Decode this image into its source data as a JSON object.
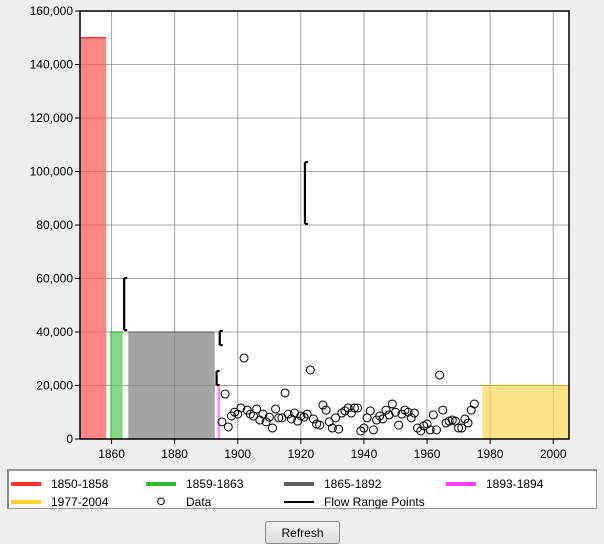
{
  "chart_data": {
    "type": "bar",
    "title": "",
    "xlabel": "",
    "ylabel": "",
    "xlim": [
      1850,
      2005
    ],
    "ylim": [
      0,
      160000
    ],
    "grid": true,
    "x_ticks": [
      1860,
      1880,
      1900,
      1920,
      1940,
      1960,
      1980,
      2000
    ],
    "y_ticks": [
      0,
      20000,
      40000,
      60000,
      80000,
      100000,
      120000,
      140000,
      160000
    ],
    "y_tick_labels": [
      "0",
      "20,000",
      "40,000",
      "60,000",
      "80,000",
      "100,000",
      "120,000",
      "140,000",
      "160,000"
    ],
    "period_bars": [
      {
        "name": "1850-1858",
        "start": 1850,
        "end": 1858.3,
        "value": 150000,
        "color": "#ff7f7f",
        "edge": "#e00000"
      },
      {
        "name": "1859-1863",
        "start": 1859.5,
        "end": 1863.5,
        "value": 40000,
        "color": "#7fd67f",
        "edge": "#20b020"
      },
      {
        "name": "1865-1892",
        "start": 1865.3,
        "end": 1892.7,
        "value": 40000,
        "color": "#9f9f9f",
        "edge": "#606060"
      },
      {
        "name": "1893-1894",
        "start": 1893.6,
        "end": 1894.4,
        "value": 20000,
        "color": "#ff7fff",
        "edge": "#ff40ff"
      },
      {
        "name": "1977-2004",
        "start": 1977.5,
        "end": 2005,
        "value": 20000,
        "color": "#ffe07f",
        "edge": "#f0c000"
      }
    ],
    "flow_range_points": [
      {
        "x": 1864.0,
        "low": 40700,
        "high": 60200
      },
      {
        "x": 1894.3,
        "low": 35100,
        "high": 40400
      },
      {
        "x": 1893.3,
        "low": 20200,
        "high": 25400
      },
      {
        "x": 1921.3,
        "low": 80400,
        "high": 103500
      }
    ],
    "scatter": {
      "name": "Data",
      "x": [
        1895,
        1896,
        1897,
        1898,
        1899,
        1900,
        1901,
        1902,
        1903,
        1904,
        1905,
        1906,
        1907,
        1908,
        1909,
        1910,
        1911,
        1912,
        1913,
        1914,
        1915,
        1916,
        1917,
        1918,
        1919,
        1920,
        1921,
        1922,
        1923,
        1924,
        1925,
        1926,
        1927,
        1928,
        1929,
        1930,
        1931,
        1932,
        1933,
        1934,
        1935,
        1936,
        1937,
        1938,
        1939,
        1940,
        1941,
        1942,
        1943,
        1944,
        1945,
        1946,
        1947,
        1948,
        1949,
        1950,
        1951,
        1952,
        1953,
        1954,
        1955,
        1956,
        1957,
        1958,
        1959,
        1960,
        1961,
        1962,
        1963,
        1964,
        1965,
        1966,
        1967,
        1968,
        1969,
        1970,
        1971,
        1972,
        1973,
        1974,
        1975
      ],
      "y": [
        6400,
        16800,
        4500,
        8600,
        10000,
        9300,
        11600,
        30300,
        10800,
        9300,
        8600,
        11200,
        7100,
        9300,
        6400,
        8200,
        4100,
        11200,
        7900,
        7900,
        17200,
        9300,
        7500,
        9700,
        6700,
        8600,
        8200,
        9300,
        25800,
        7500,
        5600,
        5200,
        12700,
        10800,
        6400,
        4100,
        7900,
        3700,
        9700,
        10500,
        11600,
        9700,
        11600,
        11600,
        3000,
        4100,
        7900,
        10500,
        3400,
        7100,
        8600,
        7500,
        10800,
        9000,
        13100,
        10000,
        5200,
        9300,
        10800,
        10000,
        7900,
        9700,
        4100,
        3000,
        4900,
        5600,
        3400,
        9000,
        3400,
        23900,
        10800,
        6000,
        6700,
        7100,
        6700,
        4100,
        4100,
        7500,
        6000,
        10800,
        13100
      ]
    },
    "legend": {
      "placement": "bottom",
      "items": [
        {
          "label": "1850-1858",
          "type": "line",
          "color": "#ff3030"
        },
        {
          "label": "1859-1863",
          "type": "line",
          "color": "#30b830"
        },
        {
          "label": "1865-1892",
          "type": "line",
          "color": "#606060"
        },
        {
          "label": "1893-1894",
          "type": "line",
          "color": "#ff40ff"
        },
        {
          "label": "1977-2004",
          "type": "line",
          "color": "#ffd030"
        },
        {
          "label": "Data",
          "type": "marker",
          "symbol": "O"
        },
        {
          "label": "Flow Range Points",
          "type": "line",
          "color": "#000000"
        }
      ]
    }
  },
  "controls": {
    "refresh_label": "Refresh"
  }
}
